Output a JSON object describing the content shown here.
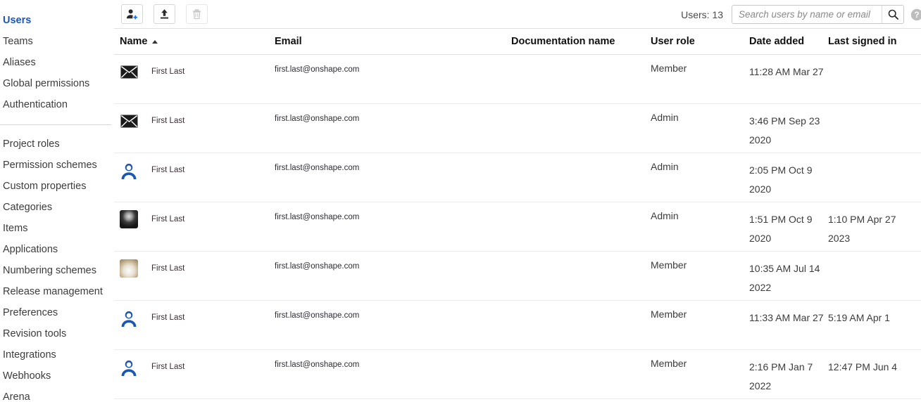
{
  "sidebar": {
    "group1": [
      {
        "label": "Users",
        "active": true
      },
      {
        "label": "Teams",
        "active": false
      },
      {
        "label": "Aliases",
        "active": false
      },
      {
        "label": "Global permissions",
        "active": false
      },
      {
        "label": "Authentication",
        "active": false
      }
    ],
    "group2": [
      {
        "label": "Project roles"
      },
      {
        "label": "Permission schemes"
      },
      {
        "label": "Custom properties"
      },
      {
        "label": "Categories"
      },
      {
        "label": "Items"
      },
      {
        "label": "Applications"
      },
      {
        "label": "Numbering schemes"
      },
      {
        "label": "Release management"
      },
      {
        "label": "Preferences"
      },
      {
        "label": "Revision tools"
      },
      {
        "label": "Integrations"
      },
      {
        "label": "Webhooks"
      },
      {
        "label": "Arena"
      }
    ],
    "scrollbar": {
      "up_icon": "caret-up-icon",
      "down_icon": "caret-down-icon"
    }
  },
  "toolbar": {
    "add_user_label": "add-user",
    "upload_label": "upload",
    "delete_label": "delete",
    "users_count": "Users: 13",
    "help_label": "help"
  },
  "search": {
    "value": "",
    "placeholder": "Search users by name or email",
    "button_label": "search"
  },
  "table": {
    "columns": [
      {
        "label": "Name",
        "sorted": "asc"
      },
      {
        "label": "Email",
        "sorted": ""
      },
      {
        "label": "Documentation name",
        "sorted": ""
      },
      {
        "label": "User role",
        "sorted": ""
      },
      {
        "label": "Date added",
        "sorted": ""
      },
      {
        "label": "Last signed in",
        "sorted": ""
      }
    ],
    "rows": [
      {
        "avatar": "envelope-icon",
        "name": "First Last",
        "email": "first.last@onshape.com",
        "doc_name": "",
        "role": "Member",
        "date_added": "11:28 AM Mar 27",
        "last_signed_in": ""
      },
      {
        "avatar": "envelope-icon",
        "name": "First Last",
        "email": "first.last@onshape.com",
        "doc_name": "",
        "role": "Admin",
        "date_added": "3:46 PM Sep 23 2020",
        "last_signed_in": ""
      },
      {
        "avatar": "person-avatar-icon",
        "name": "First Last",
        "email": "first.last@onshape.com",
        "doc_name": "",
        "role": "Admin",
        "date_added": "2:05 PM Oct 9 2020",
        "last_signed_in": ""
      },
      {
        "avatar": "photo-dark-avatar",
        "name": "First Last",
        "email": "first.last@onshape.com",
        "doc_name": "",
        "role": "Admin",
        "date_added": "1:51 PM Oct 9 2020",
        "last_signed_in": "1:10 PM Apr 27 2023"
      },
      {
        "avatar": "photo-light-avatar",
        "name": "First Last",
        "email": "first.last@onshape.com",
        "doc_name": "",
        "role": "Member",
        "date_added": "10:35 AM Jul 14 2022",
        "last_signed_in": ""
      },
      {
        "avatar": "person-avatar-icon",
        "name": "First Last",
        "email": "first.last@onshape.com",
        "doc_name": "",
        "role": "Member",
        "date_added": "11:33 AM Mar 27",
        "last_signed_in": "5:19 AM Apr 1"
      },
      {
        "avatar": "person-avatar-icon",
        "name": "First Last",
        "email": "first.last@onshape.com",
        "doc_name": "",
        "role": "Member",
        "date_added": "2:16 PM Jan 7 2022",
        "last_signed_in": "12:47 PM Jun 4"
      }
    ]
  },
  "colors": {
    "accent_blue": "#1a56c4",
    "avatar_blue": "#1c56b5",
    "border": "#e0e0e0",
    "text": "#3c3c3c",
    "muted": "#8a8a8a"
  }
}
